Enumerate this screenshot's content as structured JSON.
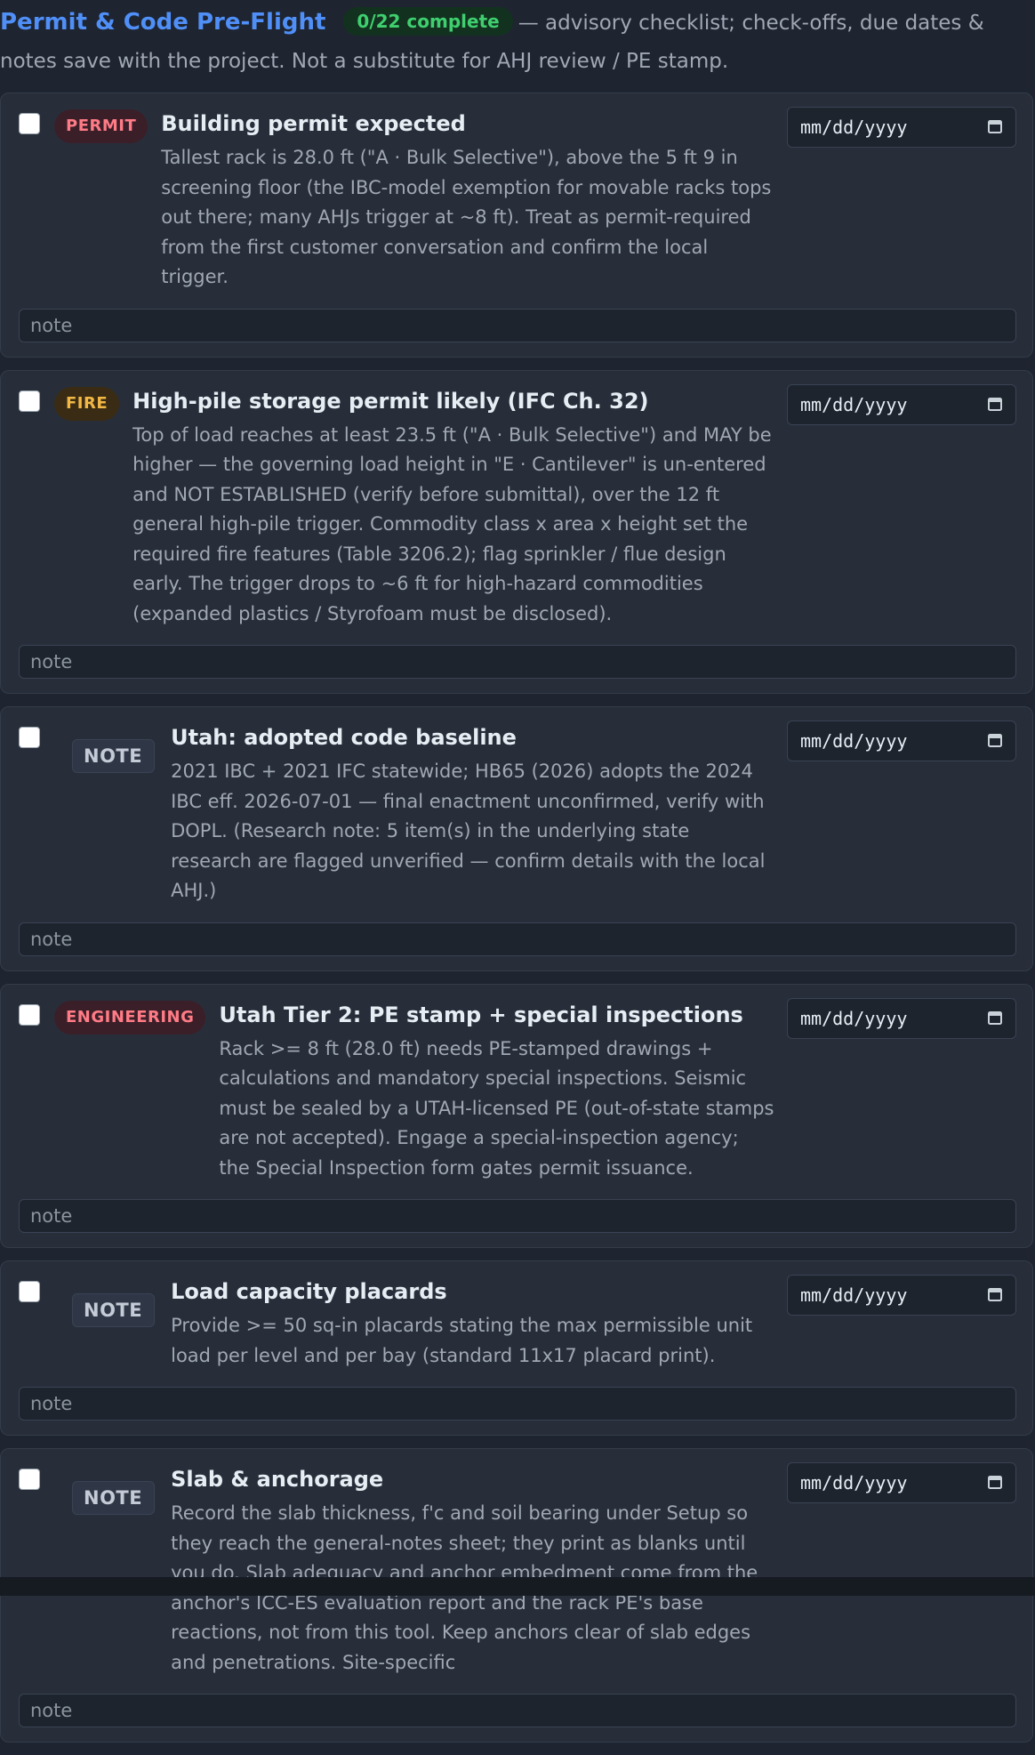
{
  "header": {
    "title": "Permit & Code Pre-Flight",
    "progress": "0/22 complete",
    "description": "— advisory checklist; check-offs, due dates & notes save with the project. Not a substitute for AHJ review / PE stamp."
  },
  "date_placeholder": "mm/dd/yyyy",
  "note_placeholder": "note",
  "items": [
    {
      "tag": "PERMIT",
      "tag_kind": "permit",
      "checked": false,
      "title": "Building permit expected",
      "description": "Tallest rack is 28.0 ft (\"A · Bulk Selective\"), above the 5 ft 9 in screening floor (the IBC-model exemption for movable racks tops out there; many AHJs trigger at ~8 ft). Treat as permit-required from the first customer conversation and confirm the local trigger."
    },
    {
      "tag": "FIRE",
      "tag_kind": "fire",
      "checked": false,
      "title": "High-pile storage permit likely (IFC Ch. 32)",
      "description": "Top of load reaches at least 23.5 ft (\"A · Bulk Selective\") and MAY be higher — the governing load height in \"E · Cantilever\" is un-entered and NOT ESTABLISHED (verify before submittal), over the 12 ft general high-pile trigger. Commodity class x area x height set the required fire features (Table 3206.2); flag sprinkler / flue design early. The trigger drops to ~6 ft for high-hazard commodities (expanded plastics / Styrofoam must be disclosed)."
    },
    {
      "tag": "NOTE",
      "tag_kind": "note",
      "checked": false,
      "title": "Utah: adopted code baseline",
      "description": "2021 IBC + 2021 IFC statewide; HB65 (2026) adopts the 2024 IBC eff. 2026-07-01 — final enactment unconfirmed, verify with DOPL. (Research note: 5 item(s) in the underlying state research are flagged unverified — confirm details with the local AHJ.)"
    },
    {
      "tag": "ENGINEERING",
      "tag_kind": "engineering",
      "checked": false,
      "title": "Utah Tier 2: PE stamp + special inspections",
      "description": "Rack >= 8 ft (28.0 ft) needs PE-stamped drawings + calculations and mandatory special inspections. Seismic must be sealed by a UTAH-licensed PE (out-of-state stamps are not accepted). Engage a special-inspection agency; the Special Inspection form gates permit issuance."
    },
    {
      "tag": "NOTE",
      "tag_kind": "note",
      "checked": false,
      "title": "Load capacity placards",
      "description": "Provide >= 50 sq-in placards stating the max permissible unit load per level and per bay (standard 11x17 placard print)."
    },
    {
      "tag": "NOTE",
      "tag_kind": "note",
      "checked": false,
      "title": "Slab & anchorage",
      "description": "Record the slab thickness, f'c and soil bearing under Setup so they reach the general-notes sheet; they print as blanks until you do. Slab adequacy and anchor embedment come from the anchor's ICC-ES evaluation report and the rack PE's base reactions, not from this tool. Keep anchors clear of slab edges and penetrations. Site-specific"
    }
  ]
}
